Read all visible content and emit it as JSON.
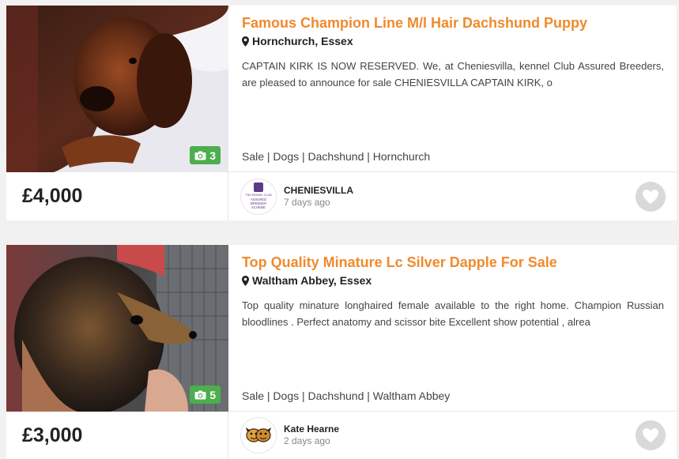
{
  "listings": [
    {
      "title": "Famous Champion Line M/l Hair Dachshund Puppy",
      "location": "Hornchurch, Essex",
      "description": "CAPTAIN KIRK IS NOW RESERVED. We, at Cheniesvilla, kennel Club Assured Breeders, are pleased to announce for sale CHENIESVILLA CAPTAIN KIRK, o",
      "tags": "Sale | Dogs | Dachshund | Hornchurch",
      "photo_count": "3",
      "price": "£4,000",
      "seller_name": "CHENIESVILLA",
      "seller_time": "7 days ago",
      "seller_avatar_lines": [
        "THE KENNEL CLUB",
        "ASSURED",
        "BREEDER",
        "SCHEME"
      ]
    },
    {
      "title": "Top Quality Minature Lc Silver Dapple For Sale",
      "location": "Waltham Abbey, Essex",
      "description": "Top quality minature longhaired female available to the right home. Champion Russian bloodlines . Perfect anatomy and scissor bite Excellent show potential , alrea",
      "tags": "Sale | Dogs | Dachshund | Waltham Abbey",
      "photo_count": "5",
      "price": "£3,000",
      "seller_name": "Kate Hearne",
      "seller_time": "2 days ago"
    }
  ],
  "icons": {
    "location": "map-marker-icon",
    "photos": "camera-icon",
    "favourite": "heart-icon"
  },
  "colors": {
    "title": "#f08a2c",
    "badge": "#4cae4c",
    "fav_bg": "#d9d9d9"
  }
}
